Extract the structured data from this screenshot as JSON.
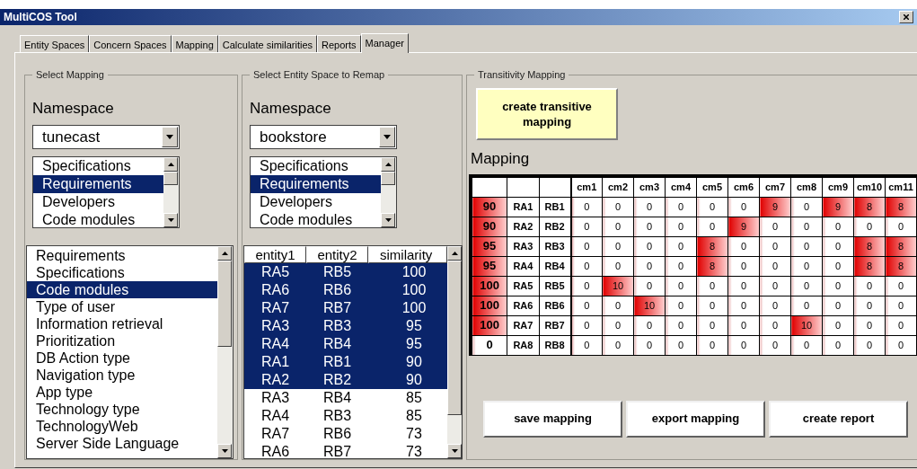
{
  "window": {
    "title": "MultiCOS Tool"
  },
  "tabs": [
    {
      "label": "Entity Spaces",
      "selected": false
    },
    {
      "label": "Concern Spaces",
      "selected": false
    },
    {
      "label": "Mapping",
      "selected": false
    },
    {
      "label": "Calculate similarities",
      "selected": false
    },
    {
      "label": "Reports",
      "selected": false
    },
    {
      "label": "Manager",
      "selected": true
    }
  ],
  "select_mapping": {
    "title": "Select Mapping",
    "namespace_label": "Namespace",
    "namespace_value": "tunecast",
    "spaces": [
      {
        "label": "Specifications",
        "selected": false
      },
      {
        "label": "Requirements",
        "selected": true
      },
      {
        "label": "Developers",
        "selected": false
      },
      {
        "label": "Code modules",
        "selected": false
      }
    ],
    "concerns": [
      {
        "label": "Requirements",
        "selected": false
      },
      {
        "label": "Specifications",
        "selected": false
      },
      {
        "label": "Code modules",
        "selected": true
      },
      {
        "label": "Type of user",
        "selected": false
      },
      {
        "label": "Information retrieval",
        "selected": false
      },
      {
        "label": "Prioritization",
        "selected": false
      },
      {
        "label": "DB Action type",
        "selected": false
      },
      {
        "label": "Navigation type",
        "selected": false
      },
      {
        "label": "App type",
        "selected": false
      },
      {
        "label": "Technology type",
        "selected": false
      },
      {
        "label": "TechnologyWeb",
        "selected": false
      },
      {
        "label": "Server Side Language",
        "selected": false
      }
    ]
  },
  "select_entity_space": {
    "title": "Select Entity Space to Remap",
    "namespace_label": "Namespace",
    "namespace_value": "bookstore",
    "spaces": [
      {
        "label": "Specifications",
        "selected": false
      },
      {
        "label": "Requirements",
        "selected": true
      },
      {
        "label": "Developers",
        "selected": false
      },
      {
        "label": "Code modules",
        "selected": false
      }
    ],
    "columns": [
      "entity1",
      "entity2",
      "similarity"
    ],
    "rows": [
      {
        "cells": [
          "RA5",
          "RB5",
          "100"
        ],
        "selected": true
      },
      {
        "cells": [
          "RA6",
          "RB6",
          "100"
        ],
        "selected": true
      },
      {
        "cells": [
          "RA7",
          "RB7",
          "100"
        ],
        "selected": true
      },
      {
        "cells": [
          "RA3",
          "RB3",
          "95"
        ],
        "selected": true
      },
      {
        "cells": [
          "RA4",
          "RB4",
          "95"
        ],
        "selected": true
      },
      {
        "cells": [
          "RA1",
          "RB1",
          "90"
        ],
        "selected": true
      },
      {
        "cells": [
          "RA2",
          "RB2",
          "90"
        ],
        "selected": true
      },
      {
        "cells": [
          "RA3",
          "RB4",
          "85"
        ],
        "selected": false
      },
      {
        "cells": [
          "RA4",
          "RB3",
          "85"
        ],
        "selected": false
      },
      {
        "cells": [
          "RA7",
          "RB6",
          "73"
        ],
        "selected": false
      },
      {
        "cells": [
          "RA6",
          "RB7",
          "73"
        ],
        "selected": false
      }
    ]
  },
  "transitivity": {
    "title": "Transitivity Mapping",
    "create_button": "create transitive mapping",
    "mapping_label": "Mapping",
    "columns": [
      "cm1",
      "cm2",
      "cm3",
      "cm4",
      "cm5",
      "cm6",
      "cm7",
      "cm8",
      "cm9",
      "cm10",
      "cm11"
    ],
    "rows": [
      {
        "score": {
          "text": "90",
          "hot": true
        },
        "a": "RA1",
        "b": "RB1",
        "cells": [
          {
            "text": "0",
            "hot": false
          },
          {
            "text": "0",
            "hot": false
          },
          {
            "text": "0",
            "hot": false
          },
          {
            "text": "0",
            "hot": false
          },
          {
            "text": "0",
            "hot": false
          },
          {
            "text": "0",
            "hot": false
          },
          {
            "text": "9",
            "hot": true
          },
          {
            "text": "0",
            "hot": false
          },
          {
            "text": "9",
            "hot": true
          },
          {
            "text": "8",
            "hot": true
          },
          {
            "text": "8",
            "hot": true
          }
        ]
      },
      {
        "score": {
          "text": "90",
          "hot": true
        },
        "a": "RA2",
        "b": "RB2",
        "cells": [
          {
            "text": "0",
            "hot": false
          },
          {
            "text": "0",
            "hot": false
          },
          {
            "text": "0",
            "hot": false
          },
          {
            "text": "0",
            "hot": false
          },
          {
            "text": "0",
            "hot": false
          },
          {
            "text": "9",
            "hot": true
          },
          {
            "text": "0",
            "hot": false
          },
          {
            "text": "0",
            "hot": false
          },
          {
            "text": "0",
            "hot": false
          },
          {
            "text": "0",
            "hot": false
          },
          {
            "text": "0",
            "hot": false
          }
        ]
      },
      {
        "score": {
          "text": "95",
          "hot": true
        },
        "a": "RA3",
        "b": "RB3",
        "cells": [
          {
            "text": "0",
            "hot": false
          },
          {
            "text": "0",
            "hot": false
          },
          {
            "text": "0",
            "hot": false
          },
          {
            "text": "0",
            "hot": false
          },
          {
            "text": "8",
            "hot": true
          },
          {
            "text": "0",
            "hot": false
          },
          {
            "text": "0",
            "hot": false
          },
          {
            "text": "0",
            "hot": false
          },
          {
            "text": "0",
            "hot": false
          },
          {
            "text": "8",
            "hot": true
          },
          {
            "text": "8",
            "hot": true
          }
        ]
      },
      {
        "score": {
          "text": "95",
          "hot": true
        },
        "a": "RA4",
        "b": "RB4",
        "cells": [
          {
            "text": "0",
            "hot": false
          },
          {
            "text": "0",
            "hot": false
          },
          {
            "text": "0",
            "hot": false
          },
          {
            "text": "0",
            "hot": false
          },
          {
            "text": "8",
            "hot": true
          },
          {
            "text": "0",
            "hot": false
          },
          {
            "text": "0",
            "hot": false
          },
          {
            "text": "0",
            "hot": false
          },
          {
            "text": "0",
            "hot": false
          },
          {
            "text": "8",
            "hot": true
          },
          {
            "text": "8",
            "hot": true
          }
        ]
      },
      {
        "score": {
          "text": "100",
          "hot": true
        },
        "a": "RA5",
        "b": "RB5",
        "cells": [
          {
            "text": "0",
            "hot": false
          },
          {
            "text": "10",
            "hot": true
          },
          {
            "text": "0",
            "hot": false
          },
          {
            "text": "0",
            "hot": false
          },
          {
            "text": "0",
            "hot": false
          },
          {
            "text": "0",
            "hot": false
          },
          {
            "text": "0",
            "hot": false
          },
          {
            "text": "0",
            "hot": false
          },
          {
            "text": "0",
            "hot": false
          },
          {
            "text": "0",
            "hot": false
          },
          {
            "text": "0",
            "hot": false
          }
        ]
      },
      {
        "score": {
          "text": "100",
          "hot": true
        },
        "a": "RA6",
        "b": "RB6",
        "cells": [
          {
            "text": "0",
            "hot": false
          },
          {
            "text": "0",
            "hot": false
          },
          {
            "text": "10",
            "hot": true
          },
          {
            "text": "0",
            "hot": false
          },
          {
            "text": "0",
            "hot": false
          },
          {
            "text": "0",
            "hot": false
          },
          {
            "text": "0",
            "hot": false
          },
          {
            "text": "0",
            "hot": false
          },
          {
            "text": "0",
            "hot": false
          },
          {
            "text": "0",
            "hot": false
          },
          {
            "text": "0",
            "hot": false
          }
        ]
      },
      {
        "score": {
          "text": "100",
          "hot": true
        },
        "a": "RA7",
        "b": "RB7",
        "cells": [
          {
            "text": "0",
            "hot": false
          },
          {
            "text": "0",
            "hot": false
          },
          {
            "text": "0",
            "hot": false
          },
          {
            "text": "0",
            "hot": false
          },
          {
            "text": "0",
            "hot": false
          },
          {
            "text": "0",
            "hot": false
          },
          {
            "text": "0",
            "hot": false
          },
          {
            "text": "10",
            "hot": true
          },
          {
            "text": "0",
            "hot": false
          },
          {
            "text": "0",
            "hot": false
          },
          {
            "text": "0",
            "hot": false
          }
        ]
      },
      {
        "score": {
          "text": "0",
          "hot": false
        },
        "a": "RA8",
        "b": "RB8",
        "cells": [
          {
            "text": "0",
            "hot": false
          },
          {
            "text": "0",
            "hot": false
          },
          {
            "text": "0",
            "hot": false
          },
          {
            "text": "0",
            "hot": false
          },
          {
            "text": "0",
            "hot": false
          },
          {
            "text": "0",
            "hot": false
          },
          {
            "text": "0",
            "hot": false
          },
          {
            "text": "0",
            "hot": false
          },
          {
            "text": "0",
            "hot": false
          },
          {
            "text": "0",
            "hot": false
          },
          {
            "text": "0",
            "hot": false
          }
        ]
      }
    ],
    "buttons": [
      "save mapping",
      "export mapping",
      "create report"
    ]
  }
}
